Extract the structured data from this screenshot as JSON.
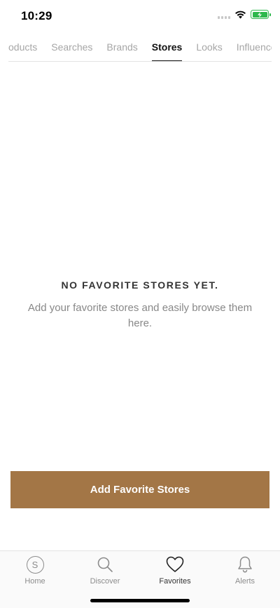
{
  "status_bar": {
    "time": "10:29"
  },
  "tabs": [
    {
      "label": "Products"
    },
    {
      "label": "Searches"
    },
    {
      "label": "Brands"
    },
    {
      "label": "Stores",
      "active": true
    },
    {
      "label": "Looks"
    },
    {
      "label": "Influencers"
    }
  ],
  "empty_state": {
    "title": "NO FAVORITE STORES YET.",
    "description": "Add your favorite stores and easily browse them here."
  },
  "cta": {
    "label": "Add Favorite Stores",
    "color": "#a37646"
  },
  "bottom_nav": {
    "items": [
      {
        "label": "Home",
        "icon": "s-circle-icon"
      },
      {
        "label": "Discover",
        "icon": "search-icon"
      },
      {
        "label": "Favorites",
        "icon": "heart-icon",
        "active": true
      },
      {
        "label": "Alerts",
        "icon": "bell-icon"
      }
    ],
    "home_glyph": "S"
  }
}
